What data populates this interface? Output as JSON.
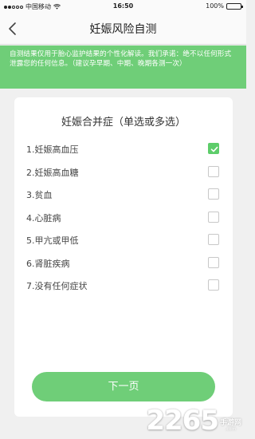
{
  "status_bar": {
    "carrier": "中国移动",
    "time": "16:50",
    "battery": "100%",
    "battery_level": 1.0
  },
  "nav": {
    "title": "妊娠风险自测",
    "back_icon": "chevron-left-icon"
  },
  "notice": {
    "text": "自测结果仅用于胎心监护结果的个性化解读。我们承诺：绝不以任何形式泄露您的任何信息。（建议孕早期、中期、晚期各测一次）"
  },
  "card": {
    "title": "妊娠合并症（单选或多选）",
    "options": [
      {
        "label": "1.妊娠高血压",
        "checked": true
      },
      {
        "label": "2.妊娠高血糖",
        "checked": false
      },
      {
        "label": "3.贫血",
        "checked": false
      },
      {
        "label": "4.心脏病",
        "checked": false
      },
      {
        "label": "5.甲亢或甲低",
        "checked": false
      },
      {
        "label": "6.肾脏疾病",
        "checked": false
      },
      {
        "label": "7.没有任何症状",
        "checked": false
      }
    ],
    "next_label": "下一页"
  },
  "watermark": {
    "number": "2265",
    "text": "手游网",
    "domain": ".com"
  },
  "colors": {
    "accent": "#6fce78",
    "checkbox_checked": "#5dcd6a",
    "background": "#f0f0f0"
  }
}
